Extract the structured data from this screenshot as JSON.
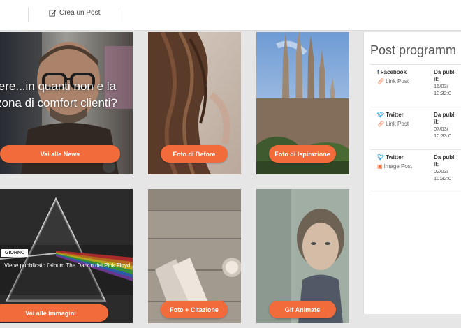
{
  "toolbar": {
    "create_post_label": "Crea un Post",
    "create_post_icon": "edit-icon"
  },
  "tiles": {
    "news": {
      "headline": "iere...in quanti non e la zona di comfort clienti?",
      "cta": "Vai alle News"
    },
    "quotes_before": {
      "cta": "Foto di Before"
    },
    "inspiration": {
      "cta": "Foto di Ispirazione"
    },
    "images": {
      "badge": "GIORNO",
      "caption": "Viene pubblicato l'album The Dark n dei Pink Floyd",
      "cta": "Vai alle immagini"
    },
    "quote_photo": {
      "cta": "Foto + Citazione"
    },
    "gif": {
      "cta": "Gif Animate"
    }
  },
  "scheduled": {
    "title": "Post programm",
    "posts": [
      {
        "network": "Facebook",
        "network_icon": "facebook-icon",
        "type": "Link Post",
        "type_icon": "link-icon",
        "label": "Da publi il:",
        "date": "15/03/ 10:32:0"
      },
      {
        "network": "Twitter",
        "network_icon": "twitter-icon",
        "type": "Link Post",
        "type_icon": "link-icon",
        "label": "Da publi il:",
        "date": "07/03/ 10:33:0"
      },
      {
        "network": "Twitter",
        "network_icon": "twitter-icon",
        "type": "Image Post",
        "type_icon": "image-icon",
        "label": "Da publi il:",
        "date": "02/03/ 10:32:0"
      }
    ]
  },
  "colors": {
    "accent": "#f26b3a",
    "facebook": "#3b5998",
    "twitter": "#1da1f2"
  }
}
